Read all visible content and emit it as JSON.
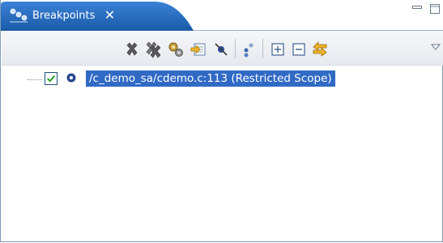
{
  "view": {
    "tab_label": "Breakpoints",
    "tab_close": "✕"
  },
  "toolbar": {
    "icons": [
      "remove-breakpoint-icon",
      "remove-all-breakpoints-icon",
      "show-breakpoints-supported-icon",
      "go-to-file-icon",
      "skip-all-breakpoints-icon",
      "group-by-icon",
      "expand-all-icon",
      "collapse-all-icon",
      "link-with-debug-view-icon",
      "view-menu-icon"
    ]
  },
  "breakpoints": [
    {
      "label": "/c_demo_sa/cdemo.c:113 (Restricted Scope)",
      "enabled": true,
      "selected": true
    }
  ],
  "colors": {
    "tab_blue": "#1c5ea8",
    "selection": "#316ac5",
    "check_green": "#1d9b1d"
  }
}
